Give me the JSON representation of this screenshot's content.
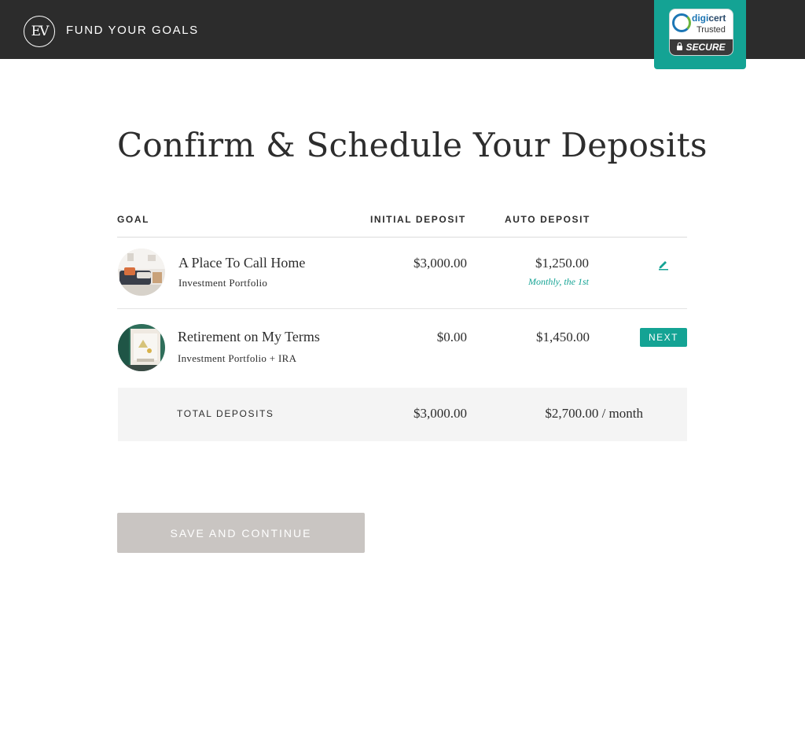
{
  "header": {
    "logo_text": "EV",
    "title": "FUND YOUR GOALS",
    "seal": {
      "brand_a": "digi",
      "brand_b": "cert",
      "trusted": "Trusted",
      "secure": "SECURE"
    }
  },
  "page_title": "Confirm & Schedule Your Deposits",
  "table": {
    "columns": {
      "goal": "GOAL",
      "initial": "INITIAL DEPOSIT",
      "auto": "AUTO DEPOSIT"
    },
    "rows": [
      {
        "name": "A Place To Call Home",
        "subtitle": "Investment Portfolio",
        "initial": "$3,000.00",
        "auto": "$1,250.00",
        "schedule": "Monthly, the 1st",
        "action_icon": "pencil-icon"
      },
      {
        "name": "Retirement on My Terms",
        "subtitle": "Investment Portfolio + IRA",
        "initial": "$0.00",
        "auto": "$1,450.00",
        "action_label": "NEXT"
      }
    ],
    "totals": {
      "label": "TOTAL DEPOSITS",
      "initial": "$3,000.00",
      "auto": "$2,700.00 / month"
    }
  },
  "actions": {
    "save_label": "SAVE AND CONTINUE"
  },
  "colors": {
    "header_bg": "#2c2c2c",
    "accent": "#14a394",
    "disabled_button": "#c9c5c2",
    "totals_bg": "#f4f4f4"
  }
}
